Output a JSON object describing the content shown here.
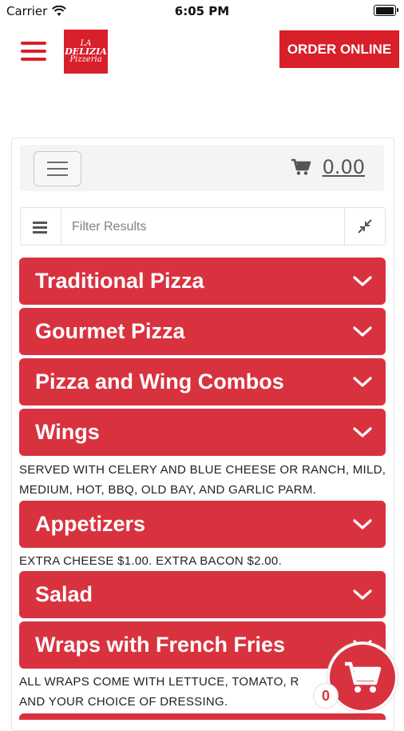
{
  "status_bar": {
    "carrier": "Carrier",
    "time": "6:05 PM"
  },
  "header": {
    "logo_line1": "LA",
    "logo_line2": "DELIZIA",
    "logo_line3": "Pizzeria",
    "order_button": "ORDER ONLINE"
  },
  "toolbar": {
    "cart_total": "0.00"
  },
  "filter": {
    "placeholder": "Filter Results"
  },
  "categories": [
    {
      "label": "Traditional Pizza"
    },
    {
      "label": "Gourmet Pizza"
    },
    {
      "label": "Pizza and Wing Combos"
    },
    {
      "label": "Wings",
      "description": "SERVED WITH CELERY AND BLUE CHEESE OR RANCH, MILD, MEDIUM, HOT, BBQ, OLD BAY, AND GARLIC PARM."
    },
    {
      "label": "Appetizers",
      "description": "EXTRA CHEESE $1.00. EXTRA BACON $2.00."
    },
    {
      "label": "Salad"
    },
    {
      "label": "Wraps with French Fries",
      "description": "ALL WRAPS COME WITH LETTUCE, TOMATO, R AND YOUR CHOICE OF DRESSING."
    }
  ],
  "floating_cart": {
    "count": "0"
  },
  "colors": {
    "brand_red": "#d81f2a",
    "category_red": "#d9323f"
  }
}
